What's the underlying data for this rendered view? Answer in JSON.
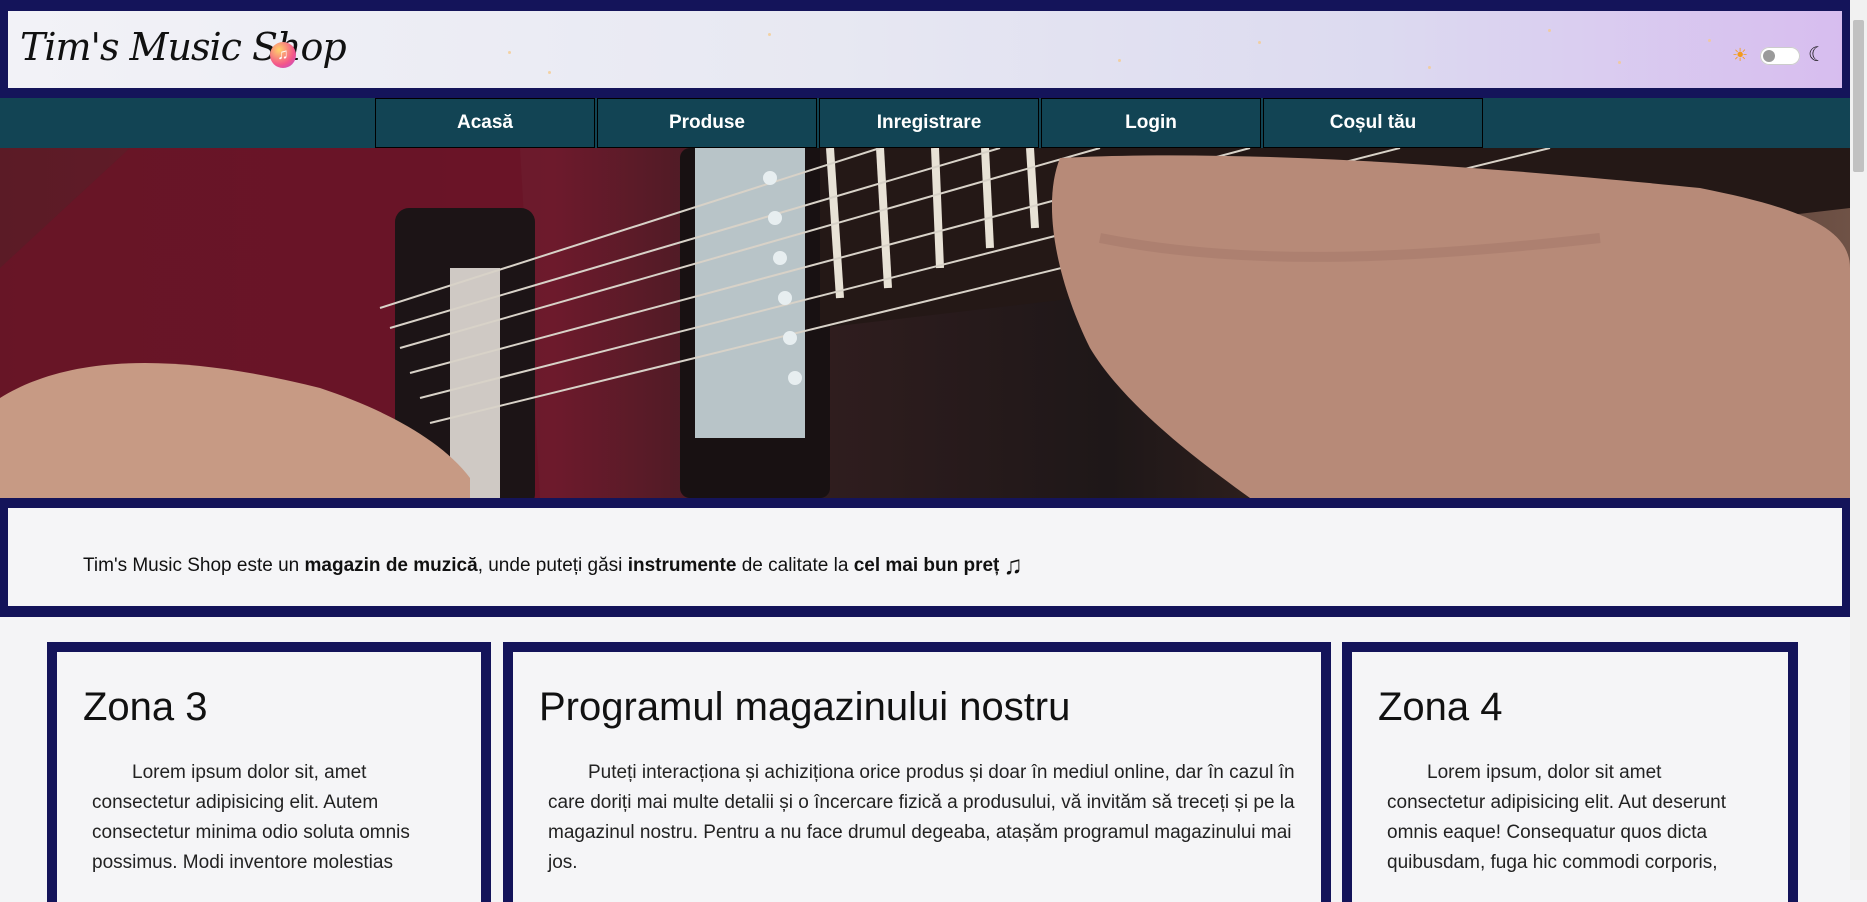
{
  "header": {
    "logo_text": "Tim's Music Shop",
    "logo_badge_icon": "music-note-icon"
  },
  "theme_toggle": {
    "sun_icon": "sun-icon",
    "moon_icon": "moon-icon",
    "state": "light"
  },
  "nav": {
    "items": [
      {
        "label": "Acasă"
      },
      {
        "label": "Produse"
      },
      {
        "label": "Inregistrare"
      },
      {
        "label": "Login"
      },
      {
        "label": "Coșul tău"
      }
    ]
  },
  "intro": {
    "part1": "Tim's Music Shop este un ",
    "bold1": "magazin de muzică",
    "part2": ", unde puteți găsi ",
    "bold2": "instrumente",
    "part3": " de calitate la ",
    "bold3": "cel mai bun preț",
    "icon": "music-note-icon"
  },
  "zones": [
    {
      "title": "Zona 3",
      "text": "Lorem ipsum dolor sit, amet consectetur adipisicing elit. Autem consectetur minima odio soluta omnis possimus. Modi inventore molestias"
    },
    {
      "title": "Programul magazinului nostru",
      "text": "Puteți interacționa și achiziționa orice produs și doar în mediul online, dar în cazul în care doriți mai multe detalii și o încercare fizică a produsului, vă invităm să treceți și pe la magazinul nostru. Pentru a nu face drumul degeaba, atașăm programul magazinului mai jos."
    },
    {
      "title": "Zona 4",
      "text": "Lorem ipsum, dolor sit amet consectetur adipisicing elit. Aut deserunt omnis eaque! Consequatur quos dicta quibusdam, fuga hic commodi corporis,"
    }
  ],
  "colors": {
    "frame": "#14145a",
    "nav_bg": "#124454",
    "page_bg": "#f4f4f6"
  }
}
